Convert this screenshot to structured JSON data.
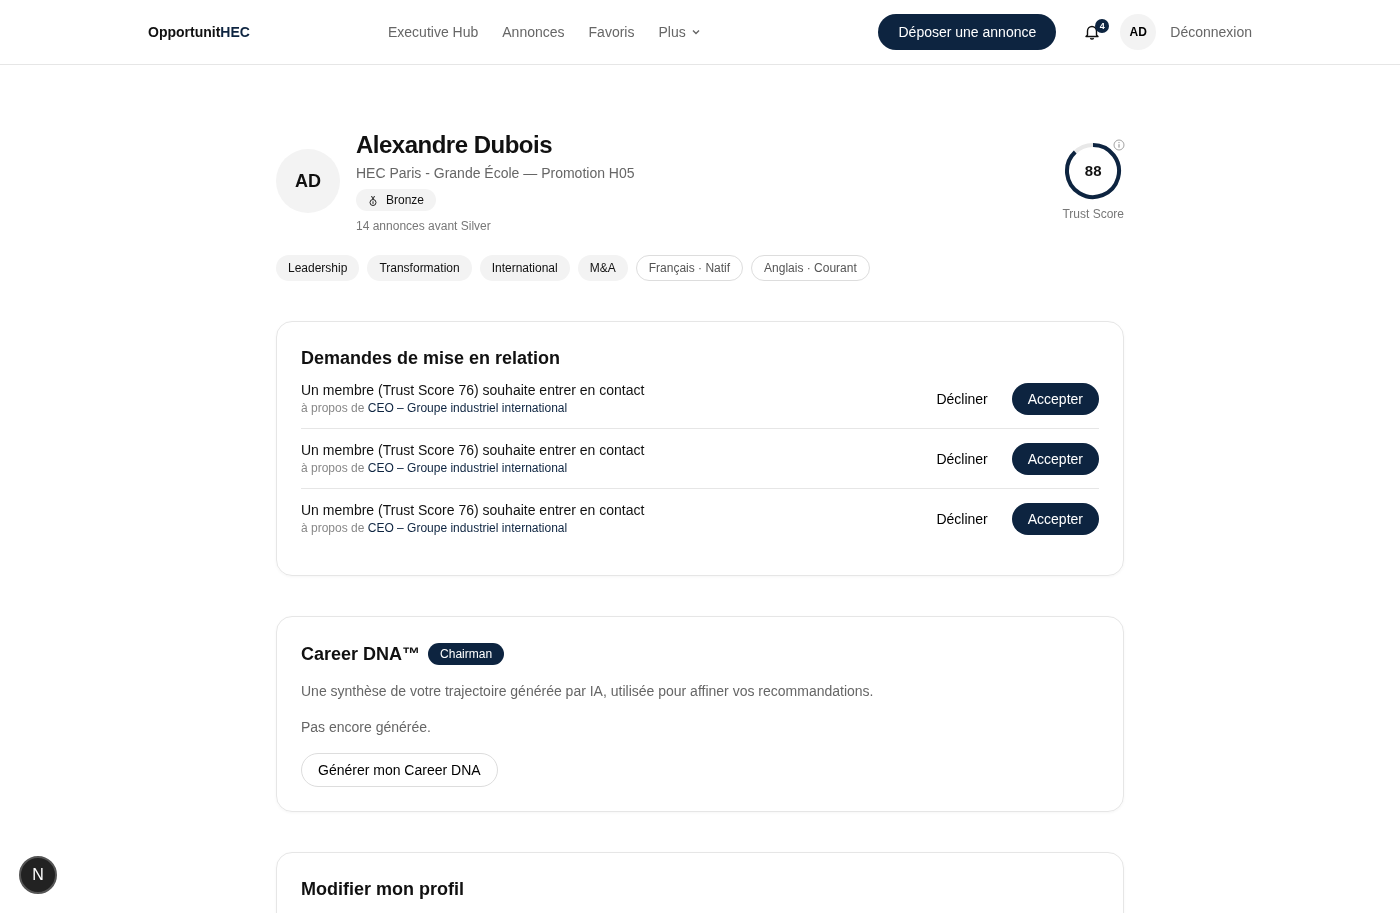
{
  "header": {
    "logo": {
      "prefix": "Opportunit",
      "suffix": "HEC"
    },
    "nav": [
      {
        "label": "Executive Hub",
        "dropdown": false
      },
      {
        "label": "Annonces",
        "dropdown": false
      },
      {
        "label": "Favoris",
        "dropdown": false
      },
      {
        "label": "Plus",
        "dropdown": true
      }
    ],
    "post_button": "Déposer une annonce",
    "notifications": "4",
    "avatar": "AD",
    "logout": "Déconnexion"
  },
  "profile": {
    "initials": "AD",
    "name": "Alexandre Dubois",
    "school": "HEC Paris - Grande École — Promotion H05",
    "tier": "Bronze",
    "tier_progress": "14 annonces avant Silver",
    "trust": {
      "score": "88",
      "label": "Trust Score",
      "level": 0.88
    },
    "tags": [
      {
        "kind": "skill",
        "label": "Leadership"
      },
      {
        "kind": "skill",
        "label": "Transformation"
      },
      {
        "kind": "skill",
        "label": "International"
      },
      {
        "kind": "skill",
        "label": "M&A"
      },
      {
        "kind": "language",
        "label": "Français · Natif"
      },
      {
        "kind": "language",
        "label": "Anglais · Courant"
      }
    ]
  },
  "requests": {
    "title": "Demandes de mise en relation",
    "items": [
      {
        "text": "Un membre (Trust Score 76) souhaite entrer en contact",
        "prefix": "à propos de",
        "subject": "CEO – Groupe industriel international",
        "decline": "Décliner",
        "accept": "Accepter"
      },
      {
        "text": "Un membre (Trust Score 76) souhaite entrer en contact",
        "prefix": "à propos de",
        "subject": "CEO – Groupe industriel international",
        "decline": "Décliner",
        "accept": "Accepter"
      },
      {
        "text": "Un membre (Trust Score 76) souhaite entrer en contact",
        "prefix": "à propos de",
        "subject": "CEO – Groupe industriel international",
        "decline": "Décliner",
        "accept": "Accepter"
      }
    ]
  },
  "career_dna": {
    "title": "Career DNA™",
    "badge": "Chairman",
    "description": "Une synthèse de votre trajectoire générée par IA, utilisée pour affiner vos recommandations.",
    "status": "Pas encore générée.",
    "button": "Générer mon Career DNA"
  },
  "edit_profile": {
    "title": "Modifier mon profil"
  },
  "dev_badge": "N"
}
